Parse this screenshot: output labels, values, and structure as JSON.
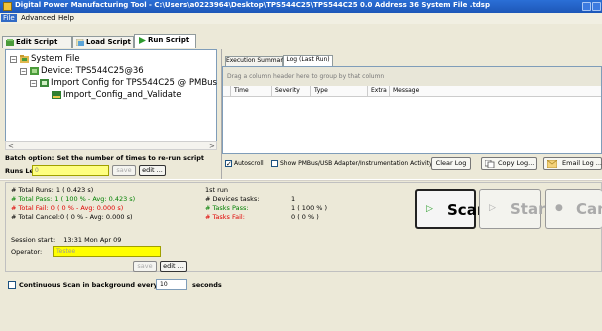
{
  "window": {
    "title": "Digital Power Manufacturing Tool - C:\\Users\\a0223964\\Desktop\\TPS544C25\\TPS544C25 0.0 Address 36 System File .tdsp"
  },
  "menu": {
    "items": [
      "File",
      "Advanced",
      "Help"
    ]
  },
  "tabs": {
    "edit": "Edit Script",
    "load": "Load Script",
    "run": "Run Script"
  },
  "tree": {
    "root": "System File",
    "device": "Device: TPS544C25@36",
    "import": "Import Config for TPS544C25 @ PMBus",
    "validate": "Import_Config_and_Validate"
  },
  "batch": {
    "label": "Batch option: Set the number of times to re-run script",
    "runs_left_label": "Runs Left #",
    "runs_left_value": "0",
    "save": "save",
    "edit": "edit ..."
  },
  "log_panel": {
    "tabs": [
      "Execution Summary",
      "Log (Last Run)"
    ],
    "group_hint": "Drag a column header here to group by that column",
    "columns": [
      "Time",
      "Severity",
      "Type",
      "Extra",
      "Message"
    ],
    "autoscroll": "Autoscroll",
    "show_pmbus": "Show PMBus/USB Adapter/Instrumentation Activity",
    "clear_log": "Clear Log",
    "copy_log": "Copy Log...",
    "email_log": "Email Log ..."
  },
  "stats": {
    "total_runs": "# Total Runs: 1 ( 0.423 s)",
    "total_pass": "# Total Pass: 1 ( 100 % - Avg: 0.423 s)",
    "total_fail": "# Total Fail:  0 ( 0 % - Avg: 0.000 s)",
    "total_cancel": "# Total Cancel:0 ( 0 % - Avg: 0.000 s)",
    "first_run": "1st run",
    "devices_tasks_label": "# Devices tasks:",
    "devices_tasks_value": "1",
    "tasks_pass_label": "# Tasks Pass:",
    "tasks_pass_value": "1 ( 100 % )",
    "tasks_fail_label": "# Tasks Fail:",
    "tasks_fail_value": "0 ( 0 % )"
  },
  "session": {
    "start_label": "Session start:",
    "start_value": "13:31 Mon Apr 09",
    "operator_label": "Operator:",
    "operator_value": "Testee",
    "save": "save",
    "edit": "edit ..."
  },
  "actions": {
    "scan": "Scan",
    "start": "Start",
    "cancel": "Cancel"
  },
  "continuous": {
    "label": "Continuous Scan in background every",
    "value": "10",
    "unit": "seconds"
  },
  "colors": {
    "pass": "#008000",
    "fail": "#e00000",
    "title_bar": "#2b6fd6",
    "highlight_input": "#ffff00"
  }
}
